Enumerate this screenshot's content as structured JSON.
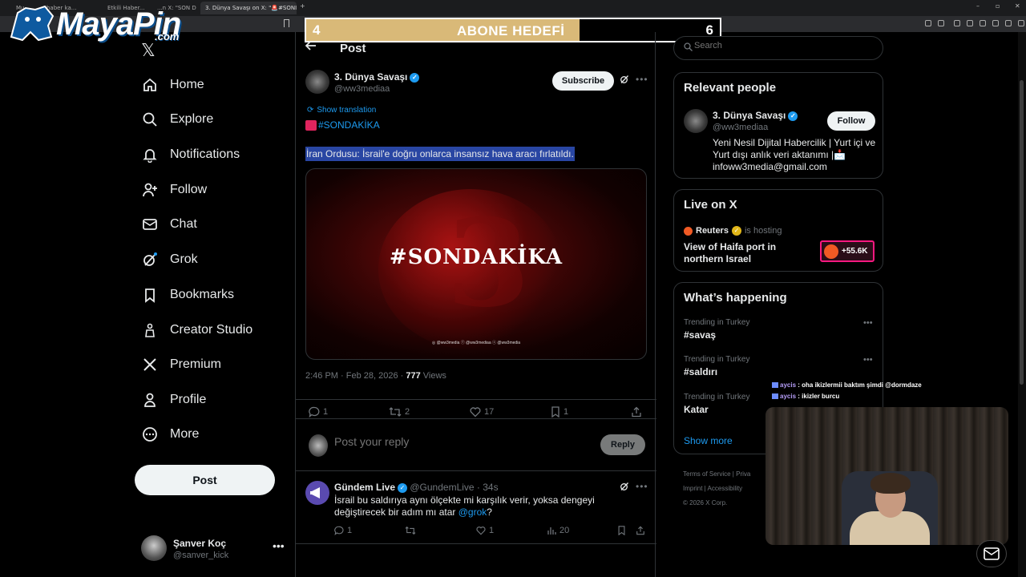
{
  "browser": {
    "tabs": [
      "Mu...",
      "haber ka...",
      "Etkili Haber...",
      "...n X: \"SON D",
      "3. Dünya Savaşı on X: \"🚨#SONI..."
    ],
    "new_tab": "+",
    "win_minimize": "–",
    "win_restore": "▫",
    "win_close": "✕"
  },
  "overlay": {
    "logo_text": "MayaPin",
    "logo_com": ".com",
    "goal_start": "4",
    "goal_title": "ABONE HEDEFİ",
    "goal_end": "6",
    "goal_progress": 0.66
  },
  "nav": {
    "items": [
      {
        "label": "Home",
        "icon": "home-icon"
      },
      {
        "label": "Explore",
        "icon": "search-icon"
      },
      {
        "label": "Notifications",
        "icon": "bell-icon"
      },
      {
        "label": "Follow",
        "icon": "person-add-icon"
      },
      {
        "label": "Chat",
        "icon": "mail-icon"
      },
      {
        "label": "Grok",
        "icon": "grok-icon"
      },
      {
        "label": "Bookmarks",
        "icon": "bookmark-icon"
      },
      {
        "label": "Creator Studio",
        "icon": "creator-studio-icon"
      },
      {
        "label": "Premium",
        "icon": "x-icon"
      },
      {
        "label": "Profile",
        "icon": "person-icon"
      },
      {
        "label": "More",
        "icon": "more-circle-icon"
      }
    ],
    "post_button": "Post",
    "account": {
      "name": "Şanver Koç",
      "handle": "@sanver_kick",
      "more": "•••"
    }
  },
  "post": {
    "header_title": "Post",
    "author_name": "3. Dünya Savaşı",
    "author_handle": "@ww3mediaa",
    "subscribe_label": "Subscribe",
    "show_translation": "Show translation",
    "hashtag": "#SONDAKİKA",
    "text": "İran Ordusu: İsrail'e doğru onlarca insansız hava aracı fırlatıldı.",
    "media_text": "#SONDAKİKA",
    "media_footer": "◎ @ww3media  ⓕ @ww3mediaa  ⓣ @ww3media",
    "timestamp": "2:46 PM · Feb 28, 2026 · ",
    "views_count": "777",
    "views_label": " Views",
    "replies": "1",
    "reposts": "2",
    "likes": "17",
    "bookmarks": "1"
  },
  "reply": {
    "placeholder": "Post your reply",
    "button": "Reply"
  },
  "comment": {
    "author_name": "Gündem Live",
    "author_handle": "@GundemLive · 34s",
    "text": "İsrail bu saldırıya aynı ölçekte mi karşılık verir, yoksa dengeyi değiştirecek bir adım mı atar ",
    "mention": "@grok",
    "text_end": "?",
    "replies": "1",
    "reposts": "",
    "likes": "1",
    "views": "20"
  },
  "right": {
    "search_placeholder": "Search",
    "relevant_title": "Relevant people",
    "relevant_name": "3. Dünya Savaşı",
    "relevant_handle": "@ww3mediaa",
    "follow_label": "Follow",
    "relevant_bio": "Yeni Nesil Dijital Habercilik | Yurt içi ve Yurt dışı anlık veri aktanımı |📩 infoww3media@gmail.com",
    "live_title": "Live on X",
    "live_host_name": "Reuters",
    "live_host_label": "is hosting",
    "live_desc": "View of Haifa port in northern Israel",
    "live_count": "+55.6K",
    "happening_title": "What’s happening",
    "trends": [
      {
        "category": "Trending in Turkey",
        "name": "#savaş"
      },
      {
        "category": "Trending in Turkey",
        "name": "#saldırı"
      },
      {
        "category": "Trending in Turkey",
        "name": "Katar"
      }
    ],
    "trend_more": "•••",
    "show_more": "Show more",
    "footer": {
      "terms": "Terms of Service",
      "privacy": "Priva",
      "imprint": "Imprint",
      "accessibility": "Accessibility",
      "copyright": "© 2026 X Corp."
    }
  },
  "stream_chat": [
    {
      "user": "aycis",
      "text": " : oha ikizlermii baktım şimdi @dormdaze"
    },
    {
      "user": "aycis",
      "text": " : ikizler burcu"
    }
  ]
}
